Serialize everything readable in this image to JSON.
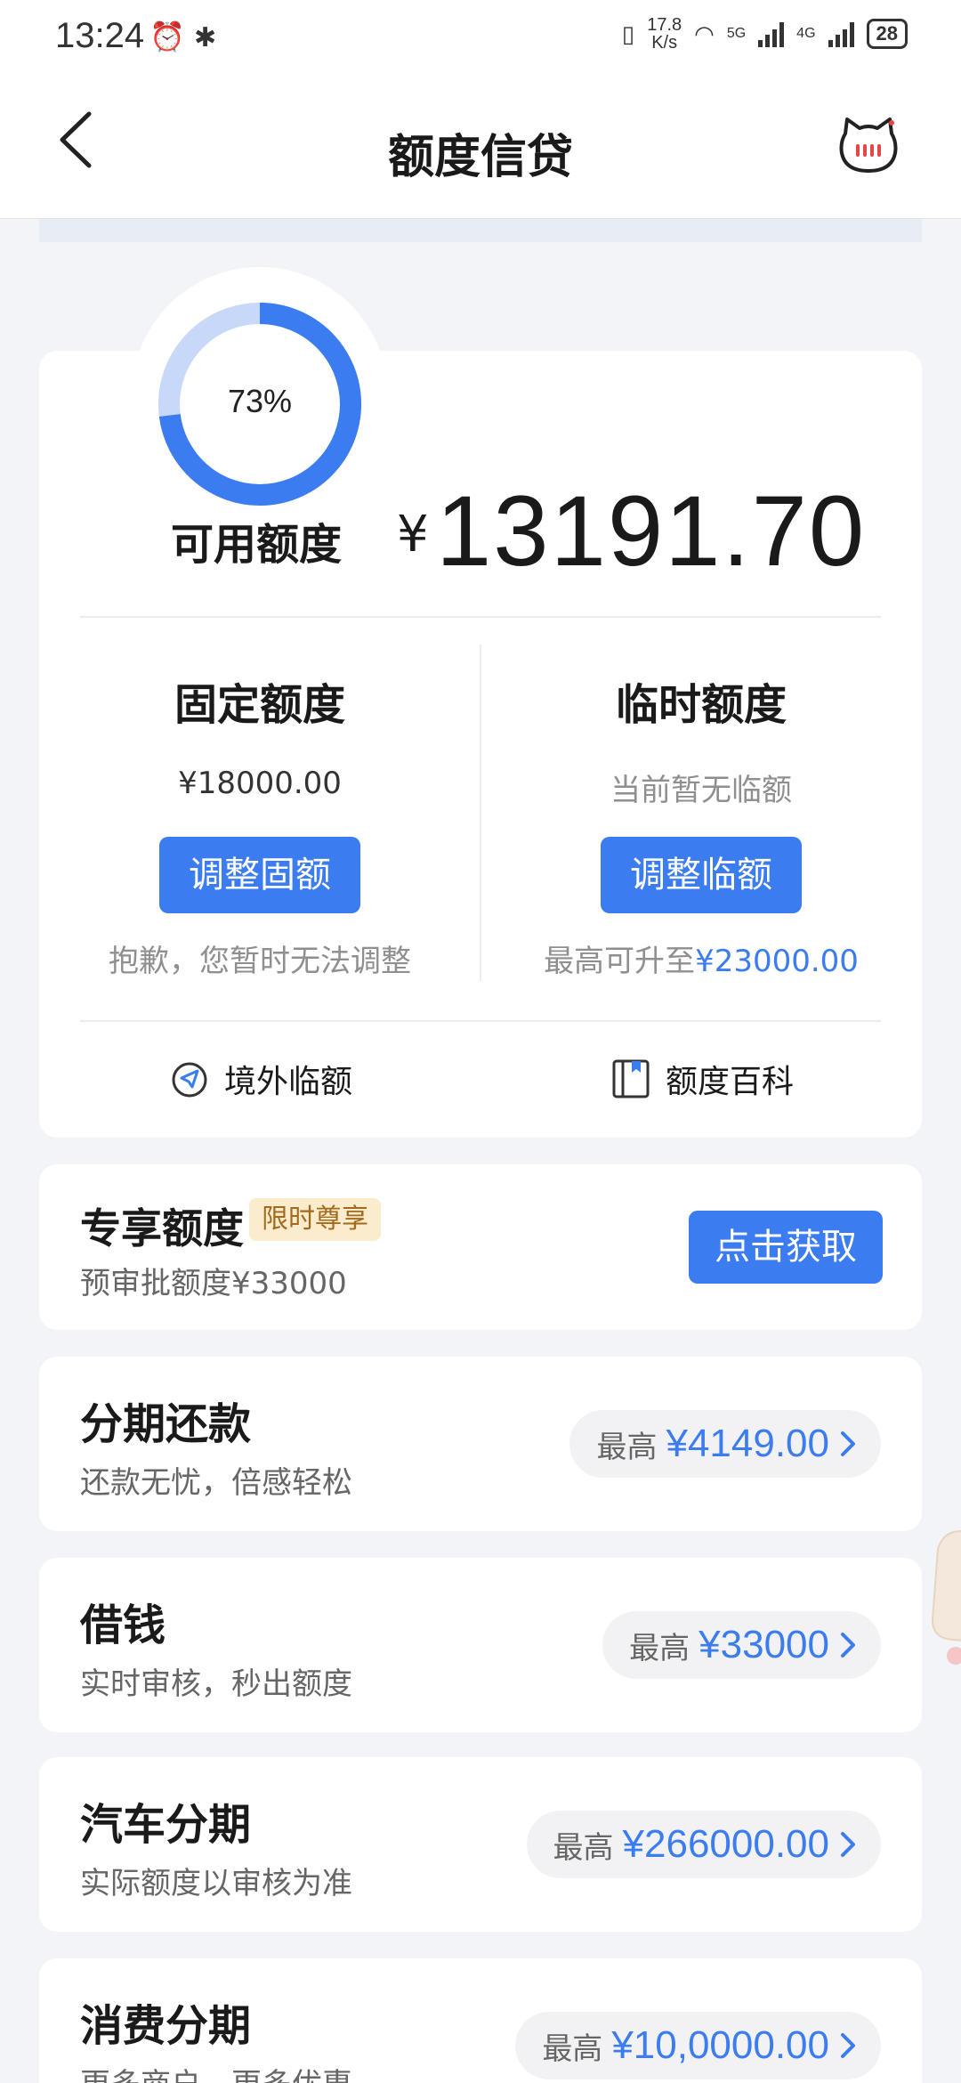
{
  "status_bar": {
    "time": "13:24",
    "net_speed_value": "17.8",
    "net_speed_unit": "K/s",
    "sig1_label": "5G",
    "sig2_label": "4G",
    "battery": "28"
  },
  "header": {
    "title": "额度信贷"
  },
  "credit": {
    "usage_percent_label": "73%",
    "usage_fraction": 0.73,
    "available_label": "可用额度",
    "currency": "¥",
    "available_amount": "13191.70",
    "fixed": {
      "title": "固定额度",
      "amount": "¥18000.00",
      "button": "调整固额",
      "note": "抱歉，您暂时无法调整"
    },
    "temp": {
      "title": "临时额度",
      "status": "当前暂无临额",
      "button": "调整临额",
      "note_prefix": "最高可升至",
      "note_amount": "¥23000.00"
    },
    "links": {
      "overseas": "境外临额",
      "wiki": "额度百科"
    }
  },
  "exclusive": {
    "title": "专享额度",
    "badge": "限时尊享",
    "subtitle": "预审批额度¥33000",
    "button": "点击获取"
  },
  "products": [
    {
      "title": "分期还款",
      "subtitle": "还款无忧，倍感轻松",
      "prefix": "最高",
      "amount": "¥4149.00"
    },
    {
      "title": "借钱",
      "subtitle": "实时审核，秒出额度",
      "prefix": "最高",
      "amount": "¥33000"
    },
    {
      "title": "汽车分期",
      "subtitle": "实际额度以审核为准",
      "prefix": "最高",
      "amount": "¥266000.00"
    },
    {
      "title": "消费分期",
      "subtitle": "更多商户，更多优惠",
      "prefix": "最高",
      "amount": "¥10,0000.00"
    }
  ],
  "colors": {
    "accent": "#3b7cf0",
    "gauge_track": "#c7d8f9",
    "badge_bg": "#fbeccd",
    "badge_text": "#a36a1c"
  },
  "icons": {
    "back": "chevron-left-icon",
    "mascot": "cat-mascot-icon",
    "overseas": "globe-plane-icon",
    "wiki": "book-icon",
    "chevron": "chevron-right-icon"
  }
}
